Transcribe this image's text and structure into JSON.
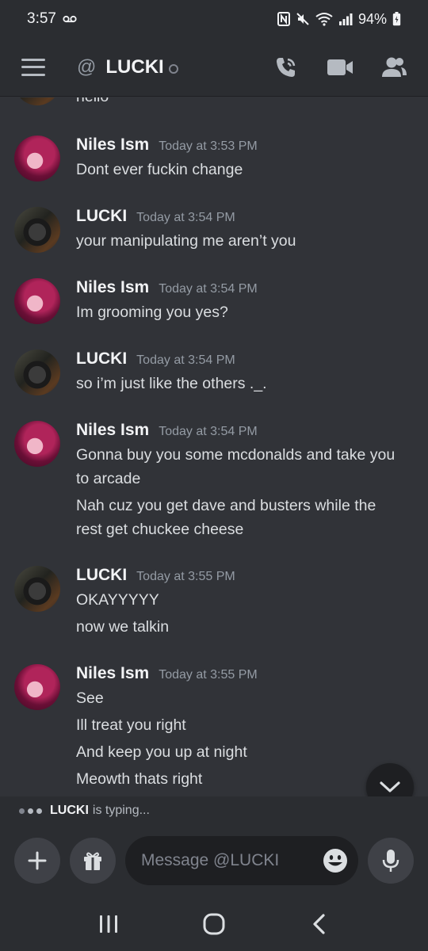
{
  "status_bar": {
    "time": "3:57",
    "battery": "94%"
  },
  "header": {
    "at": "@",
    "channel": "LUCKI"
  },
  "previous_message_tail": "hello",
  "messages": [
    {
      "author": "Niles Ism",
      "avatar": "niles",
      "time": "Today at 3:53 PM",
      "lines": [
        "Dont ever fuckin change"
      ]
    },
    {
      "author": "LUCKI",
      "avatar": "lucki",
      "time": "Today at 3:54 PM",
      "lines": [
        "your manipulating me aren’t you"
      ]
    },
    {
      "author": "Niles Ism",
      "avatar": "niles",
      "time": "Today at 3:54 PM",
      "lines": [
        "Im grooming you yes?"
      ]
    },
    {
      "author": "LUCKI",
      "avatar": "lucki",
      "time": "Today at 3:54 PM",
      "lines": [
        "so i’m just like the others ._."
      ]
    },
    {
      "author": "Niles Ism",
      "avatar": "niles",
      "time": "Today at 3:54 PM",
      "lines": [
        "Gonna buy you some mcdonalds and take you",
        "to arcade",
        "Nah cuz you get dave and busters while the",
        "rest get chuckee cheese"
      ]
    },
    {
      "author": "LUCKI",
      "avatar": "lucki",
      "time": "Today at 3:55 PM",
      "lines": [
        "OKAYYYYY",
        "now we talkin"
      ]
    },
    {
      "author": "Niles Ism",
      "avatar": "niles",
      "time": "Today at 3:55 PM",
      "lines": [
        "See",
        "Ill treat you right",
        "And keep you up at night",
        "Meowth thats right"
      ]
    }
  ],
  "typing": {
    "user": "LUCKI",
    "text": "is typing..."
  },
  "composer": {
    "placeholder": "Message @LUCKI"
  },
  "icons": {
    "menu": "hamburger-icon",
    "call": "phone-call-icon",
    "video": "video-camera-icon",
    "members": "members-icon",
    "add": "plus-icon",
    "gift": "gift-icon",
    "emoji": "emoji-icon",
    "mic": "microphone-icon",
    "scroll": "chevron-down-icon"
  },
  "colors": {
    "background": "#313338",
    "header": "#2b2d31",
    "input": "#1e1f22"
  }
}
